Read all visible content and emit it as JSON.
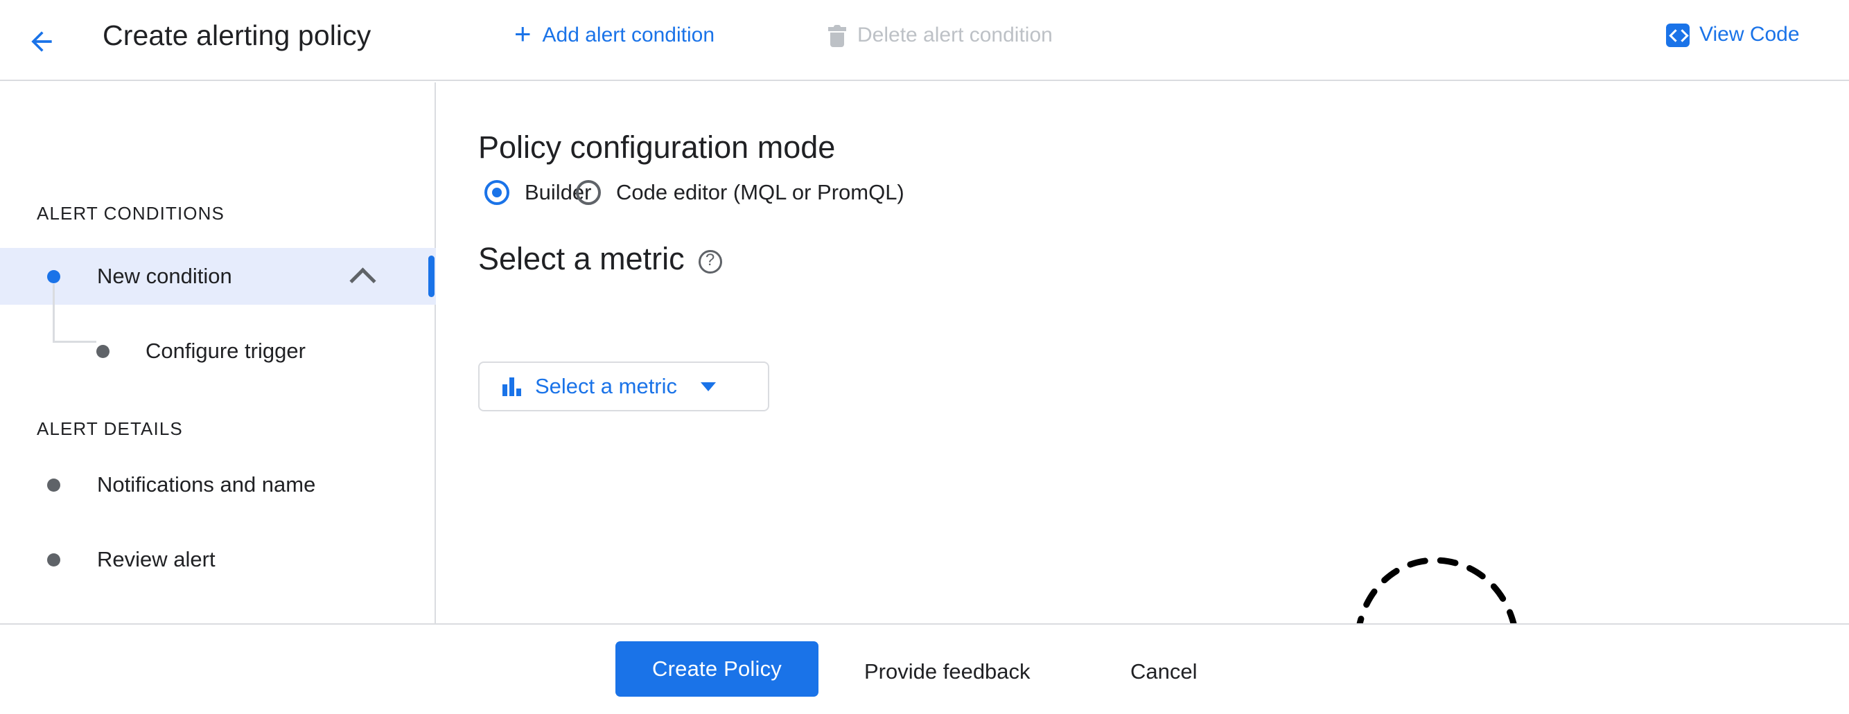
{
  "header": {
    "back_icon": "arrow-back-icon",
    "title": "Create alerting policy",
    "add_condition_label": "Add alert condition",
    "add_condition_icon": "plus-icon",
    "delete_condition_label": "Delete alert condition",
    "delete_condition_icon": "trash-icon",
    "view_code_label": "View Code",
    "view_code_icon": "code-brackets-icon"
  },
  "sidebar": {
    "sections": [
      {
        "title": "ALERT CONDITIONS"
      },
      {
        "title": "ALERT DETAILS"
      }
    ],
    "items": [
      {
        "label": "New condition",
        "selected": true,
        "chevron_icon": "chevron-up-icon"
      },
      {
        "label": "Configure trigger",
        "selected": false
      },
      {
        "label": "Notifications and name",
        "selected": false
      },
      {
        "label": "Review alert",
        "selected": false
      }
    ]
  },
  "main": {
    "mode_section": {
      "title": "Policy configuration mode",
      "options": [
        {
          "label": "Builder",
          "selected": true
        },
        {
          "label": "Code editor (MQL or PromQL)",
          "selected": false
        }
      ]
    },
    "metric_section": {
      "title": "Select a metric",
      "help_icon": "help-circle-icon",
      "dropdown": {
        "label": "Select a metric",
        "icon": "bar-chart-icon",
        "caret_icon": "caret-down-icon"
      }
    },
    "illustration": "dashed-cloud-illustration"
  },
  "footer": {
    "create_policy_label": "Create Policy",
    "provide_feedback_label": "Provide feedback",
    "cancel_label": "Cancel"
  },
  "colors": {
    "accent_blue": "#1a73e8",
    "selected_row_bg": "#e6ecfc",
    "disabled_grey": "#bdc1c6",
    "border_grey": "#dadce0",
    "text_primary": "#202124",
    "text_secondary": "#5f6368"
  }
}
